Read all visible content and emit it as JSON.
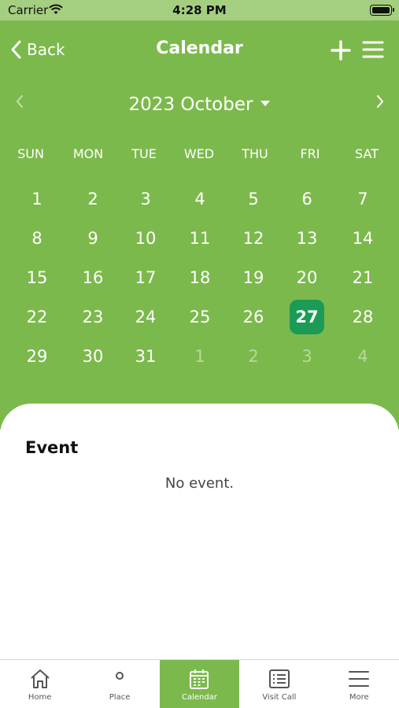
{
  "status_bar": {
    "carrier": "Carrier",
    "time": "4:28 PM"
  },
  "nav": {
    "back_label": "Back",
    "title": "Calendar"
  },
  "calendar": {
    "month_title": "2023 October",
    "weekdays": [
      "SUN",
      "MON",
      "TUE",
      "WED",
      "THU",
      "FRI",
      "SAT"
    ],
    "weeks": [
      [
        "1",
        "2",
        "3",
        "4",
        "5",
        "6",
        "7"
      ],
      [
        "8",
        "9",
        "10",
        "11",
        "12",
        "13",
        "14"
      ],
      [
        "15",
        "16",
        "17",
        "18",
        "19",
        "20",
        "21"
      ],
      [
        "22",
        "23",
        "24",
        "25",
        "26",
        "27",
        "28"
      ],
      [
        "29",
        "30",
        "31",
        "1",
        "2",
        "3",
        "4"
      ]
    ],
    "muted": [
      [
        4,
        3
      ],
      [
        4,
        4
      ],
      [
        4,
        5
      ],
      [
        4,
        6
      ]
    ],
    "selected": [
      3,
      5
    ],
    "colors": {
      "background": "#7cb94c",
      "selected": "#1b9b55"
    }
  },
  "events": {
    "heading": "Event",
    "empty_text": "No event."
  },
  "tabbar": {
    "items": [
      {
        "label": "Home",
        "icon": "home-icon"
      },
      {
        "label": "Place",
        "icon": "map-pin-icon"
      },
      {
        "label": "Calendar",
        "icon": "calendar-icon"
      },
      {
        "label": "Visit Call",
        "icon": "list-icon"
      },
      {
        "label": "More",
        "icon": "menu-icon"
      }
    ],
    "active_index": 2
  }
}
